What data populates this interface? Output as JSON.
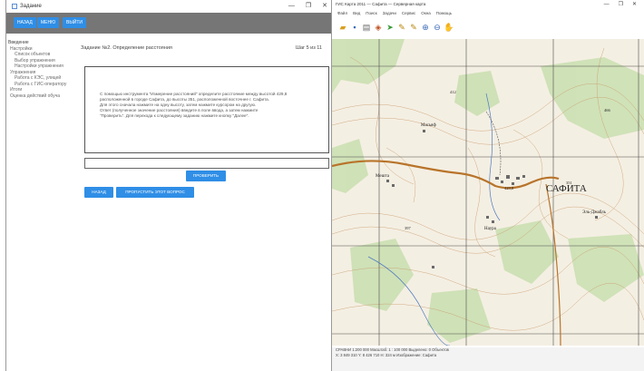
{
  "left_window": {
    "title": "Задание",
    "controls": [
      "—",
      "❐",
      "✕"
    ],
    "nav_buttons": [
      "Назад",
      "Меню",
      "Выйти"
    ],
    "sidebar": [
      {
        "label": "Введение",
        "level": 0
      },
      {
        "label": "Настройки",
        "level": 1
      },
      {
        "label": "Список объектов",
        "level": 2
      },
      {
        "label": "Выбор упражнения",
        "level": 2
      },
      {
        "label": "Настройки упражнения",
        "level": 2
      },
      {
        "label": "Упражнения",
        "level": 1
      },
      {
        "label": "Работа с КЭС, улицей",
        "level": 2
      },
      {
        "label": "Работа с ГИС-оператору",
        "level": 2
      },
      {
        "label": "Итоги",
        "level": 1
      },
      {
        "label": "Оценка действий обуча",
        "level": 1
      }
    ],
    "task_title": "Задание №2. Определение расстояния",
    "task_count": "Шаг 5 из 11",
    "task_lines": [
      "С помощью инструмента \"Измерение расстояний\" определите расстояние между высотой 429,8",
      "расположенной в городе Сафита, до высоты 351, расположенной восточнее г. Сафита.",
      "Для этого сначала нажмите на одну высоту, затем нажмите курсором на другую.",
      "Ответ (полученное значение расстояния) введите в поле ввода, а затем нажмите",
      "\"Проверить\". Для перехода к следующему заданию нажмите кнопку \"Далее\"."
    ],
    "buttons": {
      "check": "Проверить",
      "back": "Назад",
      "skip": "Пропустить этот вопрос"
    }
  },
  "right_window": {
    "title": "ГИС Карта 2011 — Сафита — Серверная карта",
    "controls": [
      "—",
      "❐",
      "✕"
    ],
    "menu": [
      "Файл",
      "Вид",
      "Поиск",
      "Задачи",
      "Сервис",
      "Окна",
      "Помощь"
    ],
    "toolbar_icons": [
      "open-icon",
      "save-icon",
      "print-icon",
      "layers-icon",
      "pointer-icon",
      "ruler-icon",
      "measure-icon",
      "zoom-in-icon",
      "zoom-out-icon",
      "hand-icon"
    ],
    "map_labels": {
      "city": "САФИТА",
      "village_1": "Мешта",
      "village_2": "Масьяф",
      "village_3": "Наура",
      "village_4": "Эль-Джабль",
      "heights": [
        "429,8",
        "351",
        "397",
        "412",
        "466"
      ]
    },
    "status_line_1": "СРАВНИ 1:200 000 Масштаб: 1 : 100 000 Выделено: 0 Объектов",
    "status_line_2": "X: 3 849 310  Y: 8 426 710  H: 324 м  Изображение: Сафита"
  }
}
